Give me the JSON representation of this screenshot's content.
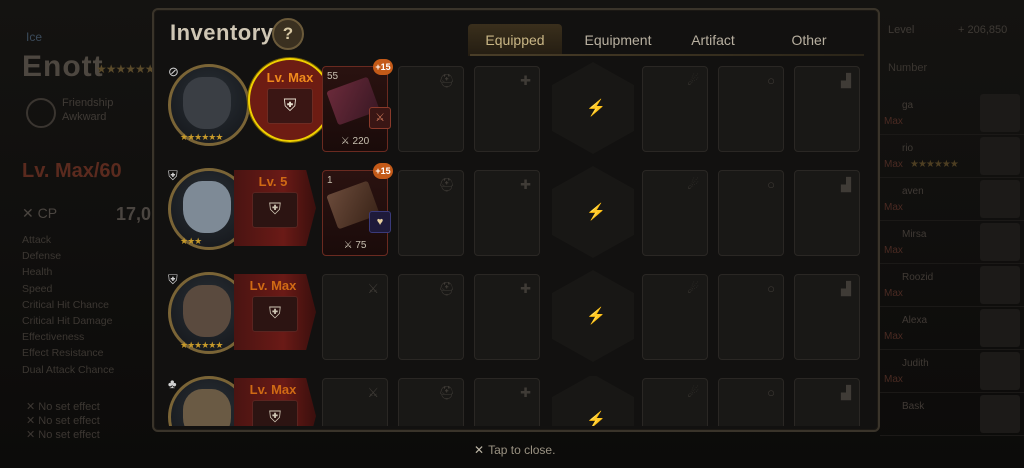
{
  "background": {
    "left": {
      "element_text": "Ice",
      "hero_name": "Enott",
      "friendship_label": "Friendship",
      "friendship_value": "Awkward",
      "level": "Lv. Max/60",
      "cp_label": "CP",
      "cp_value": "17,0",
      "stats": [
        "Attack",
        "Defense",
        "Health",
        "Speed",
        "Critical Hit Chance",
        "Critical Hit Damage",
        "Effectiveness",
        "Effect Resistance",
        "Dual Attack Chance"
      ],
      "effects": [
        "No set effect",
        "No set effect",
        "No set effect"
      ]
    },
    "right": {
      "level_label": "Level",
      "gold": "206,850",
      "filter_label": "Number",
      "roster": [
        {
          "name": "ga",
          "level": "Max"
        },
        {
          "name": "rio",
          "level": "Max"
        },
        {
          "name": "aven",
          "level": "Max"
        },
        {
          "name": "Mirsa",
          "level": "Max"
        },
        {
          "name": "Roozid",
          "level": "Max"
        },
        {
          "name": "Alexa",
          "level": "Max"
        },
        {
          "name": "Judith",
          "level": "Max"
        },
        {
          "name": "Bask",
          "level": ""
        }
      ]
    }
  },
  "inventory": {
    "title": "Inventory",
    "help": "?",
    "tabs": [
      "Equipped",
      "Equipment",
      "Artifact",
      "Other"
    ],
    "active_tab": "Equipped",
    "rows": [
      {
        "level": "Lv. Max",
        "stars": "★★★★★★",
        "highlighted": true,
        "artifact": {
          "level": "55",
          "enhance": "+15",
          "stat": "220"
        }
      },
      {
        "level": "Lv. 5",
        "stars": "★★★",
        "highlighted": false,
        "artifact": {
          "level": "1",
          "enhance": "+15",
          "stat": "75"
        }
      },
      {
        "level": "Lv. Max",
        "stars": "★★★★★★",
        "highlighted": false,
        "artifact": null
      },
      {
        "level": "Lv. Max",
        "stars": "",
        "highlighted": false,
        "artifact": null
      }
    ],
    "slot_icons": {
      "weapon": "⚔",
      "helmet": "⛑",
      "armor": "✚",
      "necklace": "☄",
      "ring": "○",
      "boots": "▟",
      "exclusive": "⚡"
    }
  },
  "footer": {
    "close_text": "Tap to close.",
    "close_icon": "✕"
  }
}
